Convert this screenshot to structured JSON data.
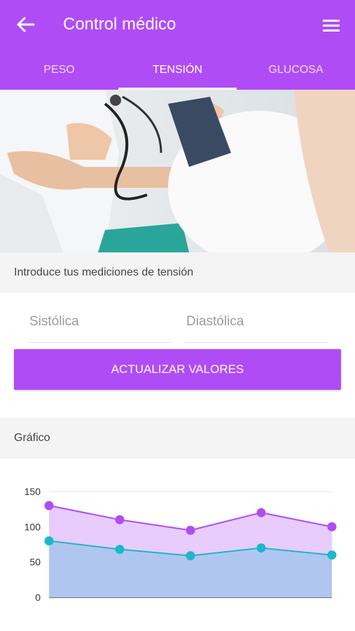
{
  "header": {
    "title": "Control médico"
  },
  "tabs": [
    {
      "label": "PESO"
    },
    {
      "label": "TENSIÓN",
      "active": true
    },
    {
      "label": "GLUCOSA"
    }
  ],
  "form": {
    "section_title": "Introduce tus mediciones de tensión",
    "systolic_placeholder": "Sistólica",
    "diastolic_placeholder": "Diastólica",
    "submit_label": "ACTUALIZAR VALORES"
  },
  "graph_section": {
    "title": "Gráfico"
  },
  "colors": {
    "primary": "#b04cf5",
    "systolic_line": "#b04cf5",
    "diastolic_line": "#1cb8c8"
  },
  "chart_data": {
    "type": "area",
    "title": "",
    "xlabel": "",
    "ylabel": "",
    "x": [
      1,
      2,
      3,
      4,
      5
    ],
    "ylim": [
      0,
      150
    ],
    "yticks": [
      "150",
      "100",
      "50",
      "0"
    ],
    "grid": true,
    "series": [
      {
        "values": [
          130,
          110,
          95,
          120,
          100
        ],
        "color": "#b04cf5",
        "fill": "#e6c6fb"
      },
      {
        "values": [
          80,
          68,
          59,
          70,
          60
        ],
        "color": "#1cb8c8",
        "fill": "#a9c7ee"
      }
    ]
  }
}
